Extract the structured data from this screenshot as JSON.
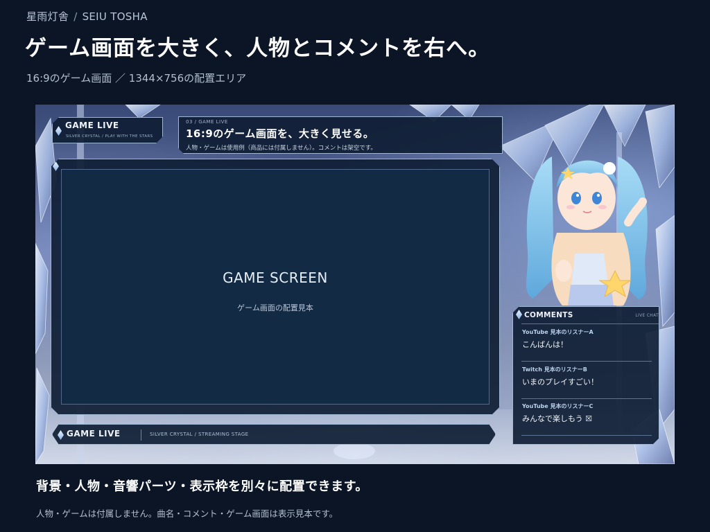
{
  "header": {
    "brand_jp": "星雨灯舎",
    "separator": "/",
    "brand_en": "SEIU TOSHA",
    "title": "ゲーム画面を大きく、人物とコメントを右へ。",
    "subtitle": "16:9のゲーム画面 ／ 1344×756の配置エリア"
  },
  "overlay": {
    "logo": {
      "title": "GAME LIVE",
      "tagline": "SILVER CRYSTAL / PLAY WITH THE STARS"
    },
    "title_bar": {
      "kicker": "03 / GAME LIVE",
      "heading": "16:9のゲーム画面を、大きく見せる。",
      "note": "人物・ゲームは使用例（商品には付属しません）。コメントは架空です。"
    },
    "game_screen": {
      "label": "GAME SCREEN",
      "sub": "ゲーム画面の配置見本"
    },
    "bottom_bar": {
      "title": "GAME LIVE",
      "tagline": "SILVER CRYSTAL / STREAMING STAGE"
    },
    "comments": {
      "heading": "COMMENTS",
      "live_tag": "LIVE CHAT",
      "items": [
        {
          "author": "YouTube  見本のリスナーA",
          "message": "こんばんは！"
        },
        {
          "author": "Twitch  見本のリスナーB",
          "message": "いまのプレイすごい！"
        },
        {
          "author": "YouTube  見本のリスナーC",
          "message": "みんなで楽しもう ☒"
        }
      ]
    }
  },
  "footer": {
    "title": "背景・人物・音響パーツ・表示枠を別々に配置できます。",
    "note": "人物・ゲームは付属しません。曲名・コメント・ゲーム画面は表示見本です。"
  },
  "colors": {
    "page_bg": "#0b1526",
    "panel_bg": "#0f1e34",
    "frame_border": "#9fb8d6",
    "game_bg": "#132a45",
    "hair": "#8cc8ec",
    "accent_pink": "#f6b3c6"
  },
  "icons": [
    "crystal-gem-icon",
    "star-icon"
  ]
}
